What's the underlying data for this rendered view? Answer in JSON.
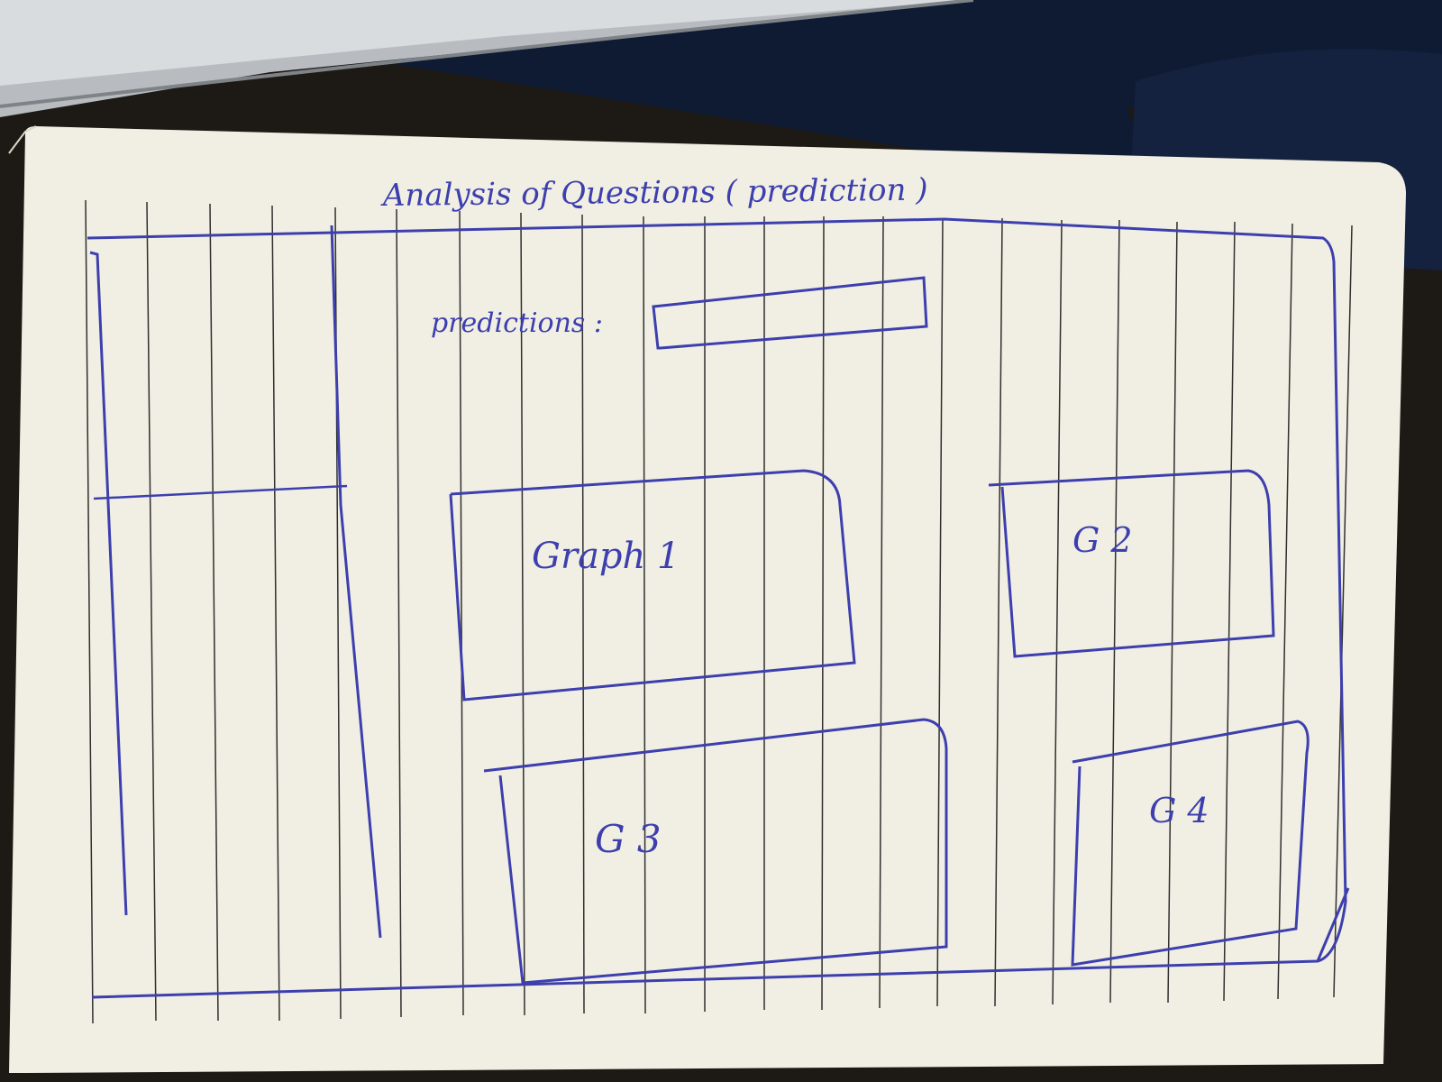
{
  "sketch": {
    "title": "Analysis of Questions ( prediction )",
    "prediction_label": "predictions :",
    "graphs": [
      {
        "label": "Graph 1"
      },
      {
        "label": "G 2"
      },
      {
        "label": "G 3"
      },
      {
        "label": "G 4"
      }
    ]
  },
  "colors": {
    "ink": "#3d3fae",
    "paper": "#f3f1e6",
    "rule_lines": "#2a2a2a",
    "background": "#1a1613",
    "laptop": "#9aa0a6"
  }
}
